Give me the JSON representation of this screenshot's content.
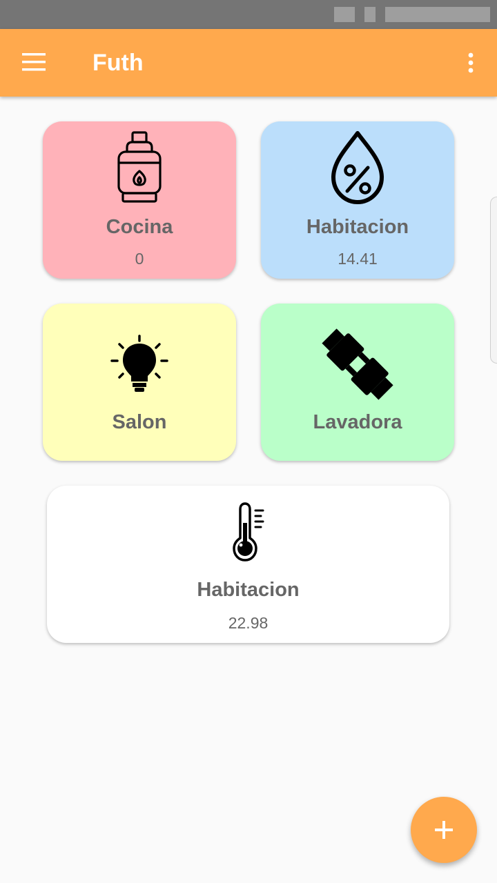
{
  "colors": {
    "accent": "#ffa94d",
    "status_bar": "#757575",
    "background": "#fafafa",
    "card_red": "#ffb2b9",
    "card_blue": "#bbdefb",
    "card_yellow": "#ffffba",
    "card_green": "#baffc9",
    "card_white": "#ffffff",
    "title_text": "#666666",
    "value_text": "#666666"
  },
  "app_bar": {
    "title": "Futh",
    "menu_icon": "hamburger-menu-icon",
    "overflow_icon": "more-vert-icon"
  },
  "cards": [
    {
      "title": "Cocina",
      "value": "0",
      "icon": "gas-cylinder-icon"
    },
    {
      "title": "Habitacion",
      "value": "14.41",
      "icon": "humidity-drop-icon"
    },
    {
      "title": "Salon",
      "value": "",
      "icon": "light-bulb-icon"
    },
    {
      "title": "Lavadora",
      "value": "",
      "icon": "plug-icon"
    },
    {
      "title": "Habitacion",
      "value": "22.98",
      "icon": "thermometer-icon"
    }
  ],
  "fab": {
    "label": "+",
    "icon": "add-icon"
  }
}
